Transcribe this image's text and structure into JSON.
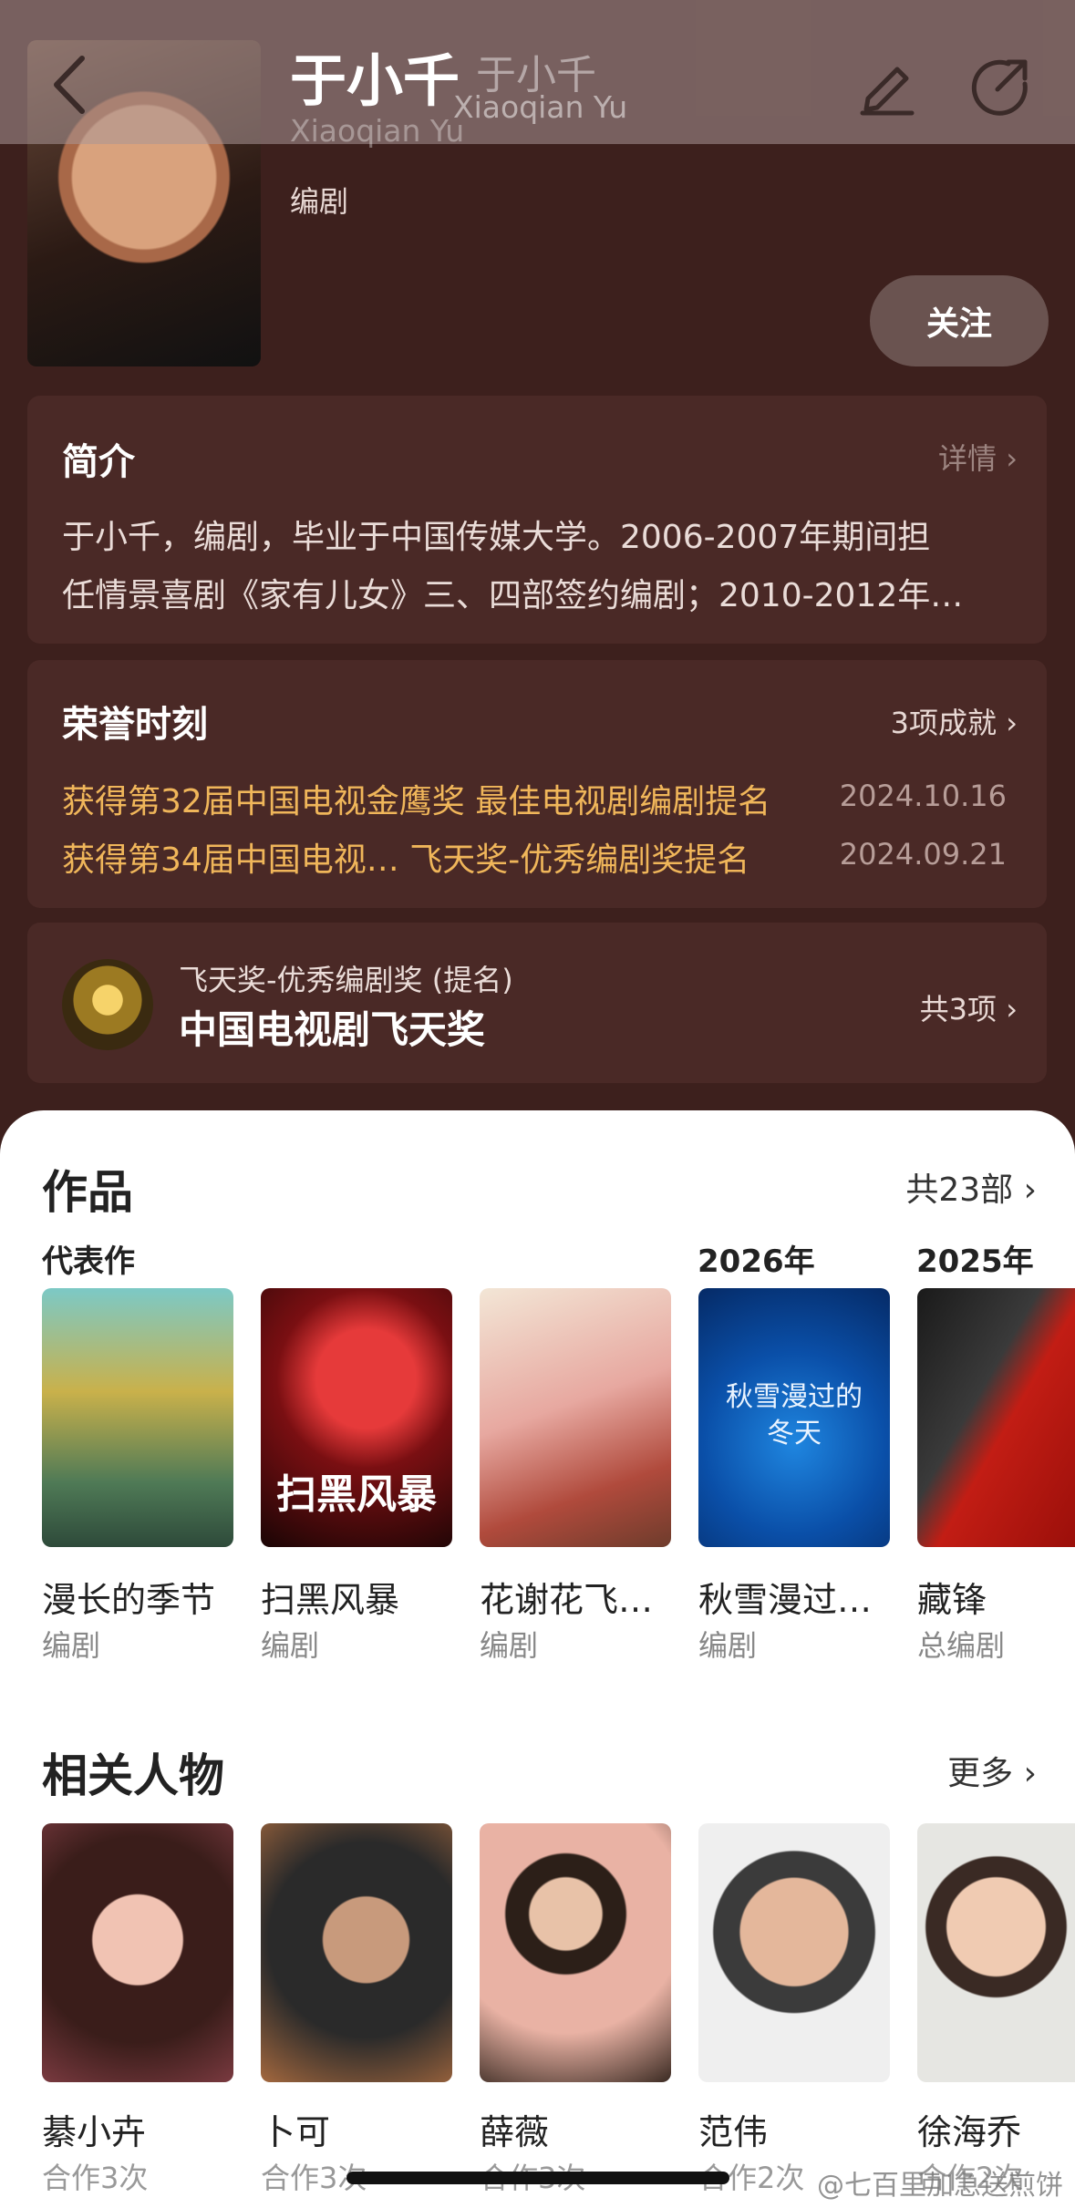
{
  "header": {
    "name": "于小千",
    "name_alt": "于小千",
    "name_en": "Xiaoqian Yu",
    "name_en_alt": "Xiaoqian Yu",
    "role": "编剧",
    "follow_label": "关注"
  },
  "intro": {
    "title": "简介",
    "link": "详情 ›",
    "line1": "于小千，编剧，毕业于中国传媒大学。2006-2007年期间担",
    "line2": "任情景喜剧《家有儿女》三、四部签约编剧；2010-2012年…"
  },
  "honors": {
    "title": "荣誉时刻",
    "link": "3项成就 ›",
    "items": [
      {
        "text": "获得第32届中国电视金鹰奖 最佳电视剧编剧提名",
        "date": "2024.10.16"
      },
      {
        "text": "获得第34届中国电视… 飞天奖-优秀编剧奖提名",
        "date": "2024.09.21"
      }
    ]
  },
  "award": {
    "subtitle": "飞天奖-优秀编剧奖 (提名)",
    "title": "中国电视剧飞天奖",
    "count": "共3项 ›"
  },
  "works": {
    "title": "作品",
    "count": "共23部 ›",
    "heads": [
      "代表作",
      "2026年",
      "2025年"
    ],
    "items": [
      {
        "name": "漫长的季节",
        "role": "编剧",
        "poster_text": ""
      },
      {
        "name": "扫黑风暴",
        "role": "编剧",
        "poster_text": "扫黑风暴"
      },
      {
        "name": "花谢花飞…",
        "role": "编剧",
        "poster_text": ""
      },
      {
        "name": "秋雪漫过…",
        "role": "编剧",
        "poster_text": "秋雪漫过的冬天"
      },
      {
        "name": "藏锋",
        "role": "总编剧",
        "poster_text": ""
      }
    ]
  },
  "people": {
    "title": "相关人物",
    "link": "更多 ›",
    "items": [
      {
        "name": "綦小卉",
        "count": "合作3次"
      },
      {
        "name": "卜可",
        "count": "合作3次"
      },
      {
        "name": "薛薇",
        "count": "合作3次"
      },
      {
        "name": "范伟",
        "count": "合作2次"
      },
      {
        "name": "徐海乔",
        "count": "合作2次"
      }
    ]
  },
  "watermark": "@七百里加急送煎饼",
  "colors": {
    "accent_gold": "#f0b65a",
    "hero_bg": "#3d201d",
    "card_bg": "#4a2926"
  }
}
